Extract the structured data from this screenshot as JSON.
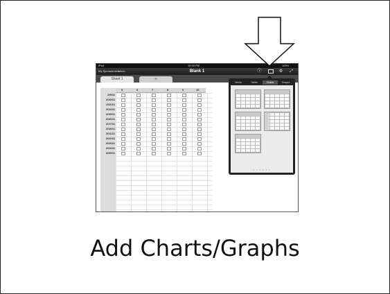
{
  "slide": {
    "caption": "Add Charts/Graphs"
  },
  "ipad": {
    "statusbar": {
      "device": "iPad",
      "time": "10:16 PM",
      "battery": "100%"
    },
    "toolbar": {
      "my_spreadsheets": "My Spreadsheets",
      "undo": "Undo",
      "title": "Blank 1",
      "icons": [
        "info-icon",
        "media-icon",
        "wrench-icon",
        "fullscreen-icon"
      ]
    },
    "tabs": [
      {
        "label": "Sheet 1"
      },
      {
        "label": "+"
      }
    ],
    "sheet": {
      "column_headers": [
        "5",
        "6",
        "7",
        "8",
        "9",
        "10"
      ],
      "row_labels": [
        "2/9/11",
        "2/10/11",
        "2/11/11",
        "2/14/11",
        "2/15/11",
        "2/16/11",
        "2/17/11",
        "2/18/11",
        "2/21/11",
        "2/22/11",
        "2/23/11",
        "2/24/11",
        "2/25/11"
      ]
    },
    "popover": {
      "tabs": [
        "Media",
        "Tables",
        "Charts",
        "Shapes"
      ],
      "selected_tab": "Charts",
      "page_dots": "• • • • • •"
    }
  }
}
